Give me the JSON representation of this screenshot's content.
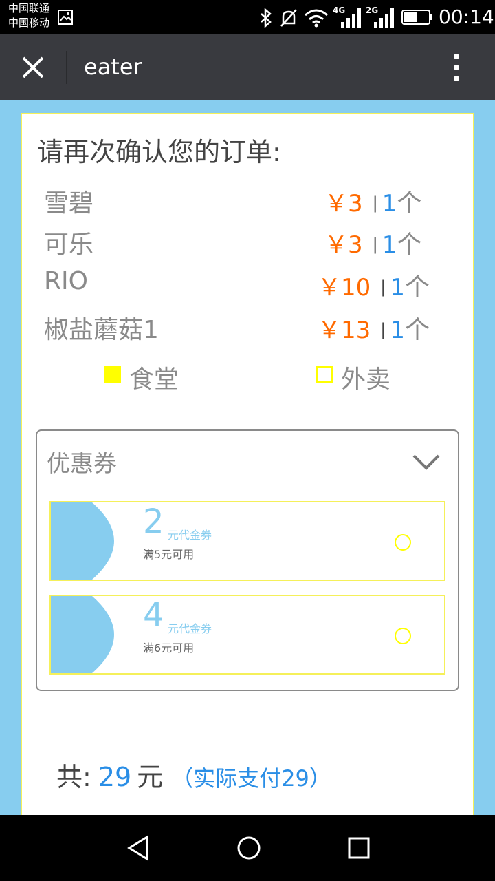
{
  "status_bar": {
    "carrier1": "中国联通",
    "carrier2": "中国移动",
    "net1": "4G",
    "net2": "2G",
    "time": "00:14"
  },
  "title_bar": {
    "title": "eater"
  },
  "order": {
    "heading": "请再次确认您的订单:",
    "items": [
      {
        "name": "雪碧",
        "price": "￥3",
        "sep": "|",
        "qty": "1",
        "unit": "个"
      },
      {
        "name": "可乐",
        "price": "￥3",
        "sep": "|",
        "qty": "1",
        "unit": "个"
      },
      {
        "name": "RIO",
        "price": "￥10",
        "sep": "|",
        "qty": "1",
        "unit": "个"
      },
      {
        "name": "椒盐蘑菇1",
        "price": "￥13",
        "sep": "|",
        "qty": "1",
        "unit": "个"
      }
    ],
    "options": [
      {
        "label": "食堂",
        "checked": true
      },
      {
        "label": "外卖",
        "checked": false
      }
    ]
  },
  "coupons": {
    "title": "优惠券",
    "list": [
      {
        "amount": "2",
        "unit": "元代金券",
        "condition": "满5元可用"
      },
      {
        "amount": "4",
        "unit": "元代金券",
        "condition": "满6元可用"
      }
    ]
  },
  "total": {
    "label": "共:",
    "value": "29",
    "unit": "元",
    "actual": "（实际支付29）"
  },
  "colors": {
    "page_background": "#87cdef",
    "price": "#ff6a00",
    "quantity": "#2a8ee6",
    "selected_option": "#ffff00",
    "coupon_border": "#f5f05a"
  }
}
